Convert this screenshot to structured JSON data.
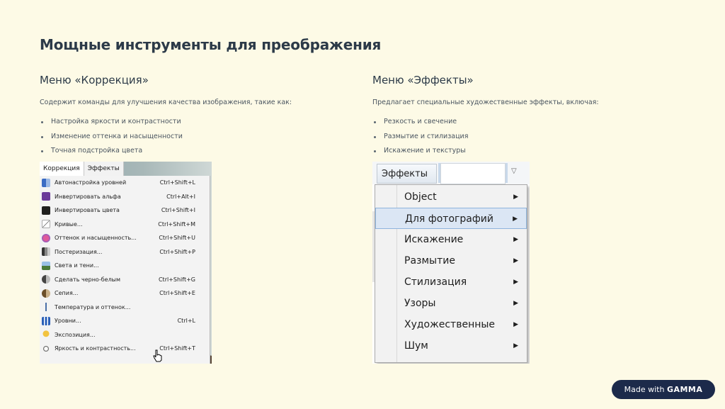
{
  "slide": {
    "title": "Мощные инструменты для преображения"
  },
  "left": {
    "heading": "Меню «Коррекция»",
    "description": "Содержит команды для улучшения качества изображения, такие как:",
    "bullets": [
      "Настройка яркости и контрастности",
      "Изменение оттенка и насыщенности",
      "Точная подстройка цвета"
    ],
    "screenshot": {
      "tabs": [
        "Коррекция",
        "Эффекты"
      ],
      "items": [
        {
          "label": "Автонастройка уровней",
          "shortcut": "Ctrl+Shift+L",
          "icon": "levels-icon"
        },
        {
          "label": "Инвертировать альфа",
          "shortcut": "Ctrl+Alt+I",
          "icon": "invert-alpha-icon"
        },
        {
          "label": "Инвертировать цвета",
          "shortcut": "Ctrl+Shift+I",
          "icon": "invert-colors-icon"
        },
        {
          "label": "Кривые...",
          "shortcut": "Ctrl+Shift+M",
          "icon": "curves-icon"
        },
        {
          "label": "Оттенок и насыщенность...",
          "shortcut": "Ctrl+Shift+U",
          "icon": "hue-saturation-icon"
        },
        {
          "label": "Постеризация...",
          "shortcut": "Ctrl+Shift+P",
          "icon": "posterize-icon"
        },
        {
          "label": "Света и тени...",
          "shortcut": "",
          "icon": "shadows-highlights-icon"
        },
        {
          "label": "Сделать черно-белым",
          "shortcut": "Ctrl+Shift+G",
          "icon": "black-white-icon"
        },
        {
          "label": "Сепия...",
          "shortcut": "Ctrl+Shift+E",
          "icon": "sepia-icon"
        },
        {
          "label": "Температура и оттенок...",
          "shortcut": "",
          "icon": "thermometer-icon"
        },
        {
          "label": "Уровни...",
          "shortcut": "Ctrl+L",
          "icon": "levels-bars-icon"
        },
        {
          "label": "Экспозиция...",
          "shortcut": "",
          "icon": "exposure-icon"
        },
        {
          "label": "Яркость и контрастность...",
          "shortcut": "Ctrl+Shift+T",
          "icon": "brightness-icon"
        }
      ]
    }
  },
  "right": {
    "heading": "Меню «Эффекты»",
    "description": "Предлагает специальные художественные эффекты, включая:",
    "bullets": [
      "Резкость и свечение",
      "Размытие и стилизация",
      "Искажение и текстуры"
    ],
    "screenshot": {
      "button_label": "Эффекты",
      "items": [
        {
          "label": "Object",
          "highlighted": false
        },
        {
          "label": "Для фотографий",
          "highlighted": true
        },
        {
          "label": "Искажение",
          "highlighted": false
        },
        {
          "label": "Размытие",
          "highlighted": false
        },
        {
          "label": "Стилизация",
          "highlighted": false
        },
        {
          "label": "Узоры",
          "highlighted": false
        },
        {
          "label": "Художественные",
          "highlighted": false
        },
        {
          "label": "Шум",
          "highlighted": false
        }
      ]
    }
  },
  "badge": {
    "prefix": "Made with",
    "brand": "GAMMA"
  },
  "colors": {
    "background": "#fdfae6",
    "badge": "#1c2a4a",
    "highlight": "#dbe6f4"
  }
}
